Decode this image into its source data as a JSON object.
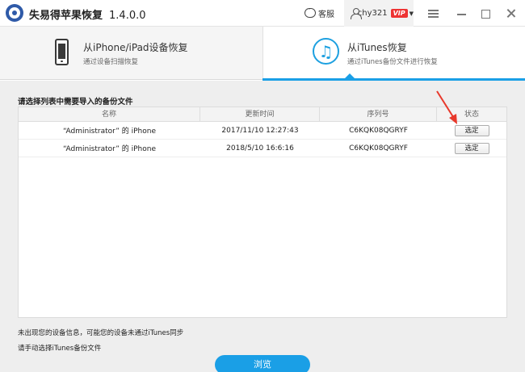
{
  "titlebar": {
    "app_name": "失易得苹果恢复",
    "version": "1.4.0.0",
    "service_label": "客服",
    "username": "chy321",
    "vip_label": "VIP"
  },
  "modes": {
    "device": {
      "title": "从iPhone/iPad设备恢复",
      "subtitle": "通过设备扫描恢复"
    },
    "itunes": {
      "title": "从iTunes恢复",
      "subtitle": "通过iTunes备份文件进行恢复"
    }
  },
  "backup_list": {
    "section_title": "请选择列表中需要导入的备份文件",
    "columns": [
      "名称",
      "更新时间",
      "序列号",
      "状态"
    ],
    "rows": [
      {
        "name": "“Administrator” 的 iPhone",
        "updated": "2017/11/10 12:27:43",
        "serial": "C6KQK08QGRYF",
        "action": "选定"
      },
      {
        "name": "“Administrator” 的 iPhone",
        "updated": "2018/5/10 16:6:16",
        "serial": "C6KQK08QGRYF",
        "action": "选定"
      }
    ]
  },
  "hints": {
    "line1": "未出现您的设备信息，可能您的设备未通过iTunes同步",
    "line2": "请手动选择iTunes备份文件"
  },
  "browse_label": "浏览",
  "colors": {
    "accent": "#1a9fe6",
    "annotation": "#e8382b"
  }
}
